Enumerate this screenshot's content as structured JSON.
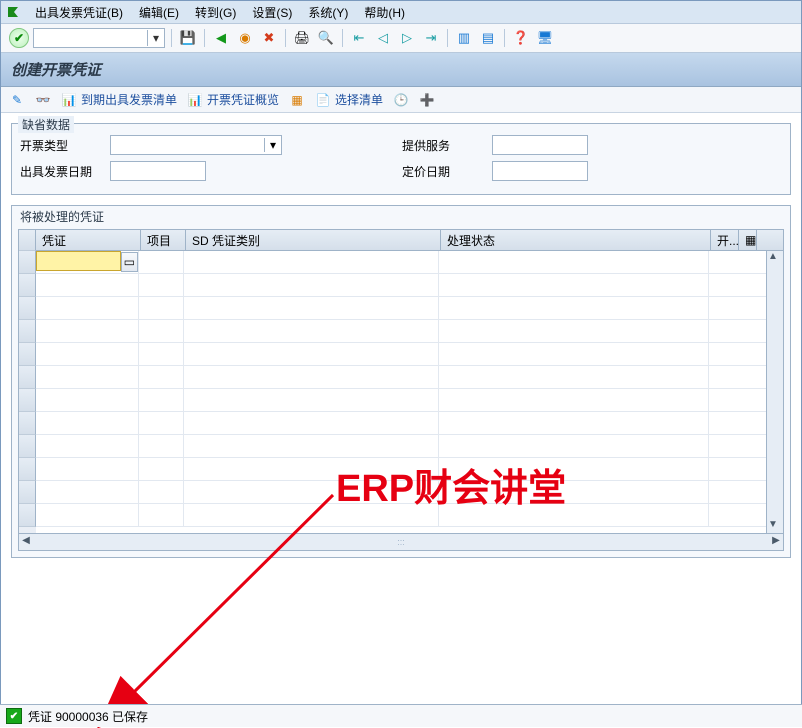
{
  "menu": {
    "items": [
      {
        "label": "出具发票凭证(B)"
      },
      {
        "label": "编辑(E)"
      },
      {
        "label": "转到(G)"
      },
      {
        "label": "设置(S)"
      },
      {
        "label": "系统(Y)"
      },
      {
        "label": "帮助(H)"
      }
    ]
  },
  "title": "创建开票凭证",
  "apptoolbar": {
    "due_list": "到期出具发票清单",
    "overview": "开票凭证概览",
    "select_list": "选择清单"
  },
  "defaults": {
    "group_title": "缺省数据",
    "billing_type_label": "开票类型",
    "billing_type_value": "",
    "invoice_date_label": "出具发票日期",
    "invoice_date_value": "",
    "service_label": "提供服务",
    "service_value": "",
    "pricing_date_label": "定价日期",
    "pricing_date_value": ""
  },
  "grid": {
    "title": "将被处理的凭证",
    "headers": {
      "voucher": "凭证",
      "item": "项目",
      "sd_type": "SD 凭证类别",
      "status": "处理状态",
      "open": "开..."
    },
    "active_value": ""
  },
  "watermark": "ERP财会讲堂",
  "status": {
    "text": "凭证 90000036 已保存"
  },
  "icons": {
    "menu": "menu-icon",
    "check": "✔",
    "save": "💾",
    "back": "⮌",
    "exit": "⮐",
    "cancel": "✖",
    "print": "🖨",
    "find": "🔍",
    "pencil": "✎",
    "glasses": "👓",
    "chart": "📊",
    "doc": "📄",
    "plus": "＋",
    "clock": "🕒",
    "square": "▢"
  }
}
